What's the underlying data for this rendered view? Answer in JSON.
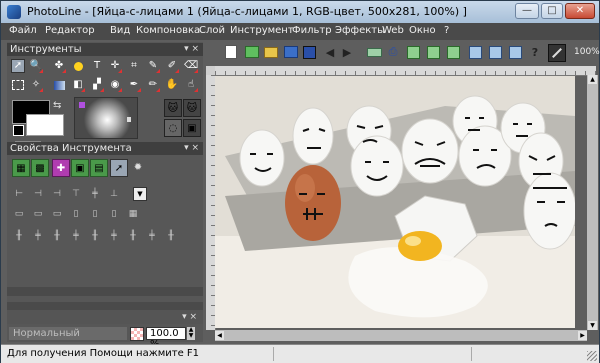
{
  "window": {
    "title": "PhotoLine - [Яйца-с-лицами 1 (Яйца-с-лицами 1, RGB-цвет, 500x281, 100%) ]",
    "minimize_label": "—",
    "restore_label": "□",
    "close_label": "✕"
  },
  "menu": {
    "items": [
      "Файл",
      "Редактор",
      "Вид",
      "Компоновка",
      "Слой",
      "Инструмент",
      "Фильтр",
      "Эффекты",
      "Web",
      "Окно",
      "?"
    ]
  },
  "panels": {
    "tools_title": "Инструменты",
    "tool_props_title": "Свойства Инструмента",
    "pin_glyphs": "▾ ×"
  },
  "layer_bar": {
    "blend_mode": "Нормальный",
    "opacity": "100.0 %"
  },
  "toolbar": {
    "zoom_label": "100%"
  },
  "status": {
    "text": "Для получения Помощи нажмите F1"
  },
  "colors": {
    "foreground": "#000000",
    "background": "#ffffff",
    "accent": "#d33333"
  }
}
